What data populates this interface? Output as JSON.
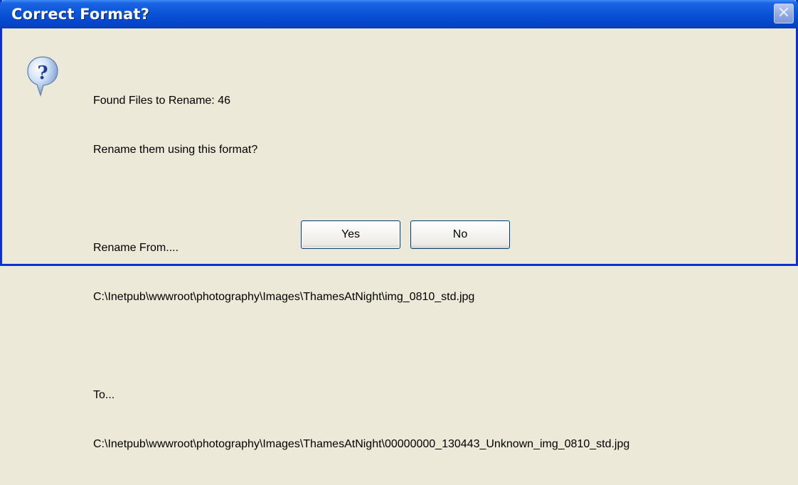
{
  "window": {
    "title": "Correct Format?",
    "close_glyph": "✕"
  },
  "icon": {
    "name": "question-icon",
    "glyph": "?"
  },
  "message": {
    "line1": "Found Files to Rename: 46",
    "line2": "Rename them using this format?",
    "from_label": "Rename From....",
    "from_path": "C:\\Inetpub\\wwwroot\\photography\\Images\\ThamesAtNight\\img_0810_std.jpg",
    "to_label": "To...",
    "to_path": "C:\\Inetpub\\wwwroot\\photography\\Images\\ThamesAtNight\\00000000_130443_Unknown_img_0810_std.jpg"
  },
  "buttons": {
    "yes": "Yes",
    "no": "No"
  }
}
